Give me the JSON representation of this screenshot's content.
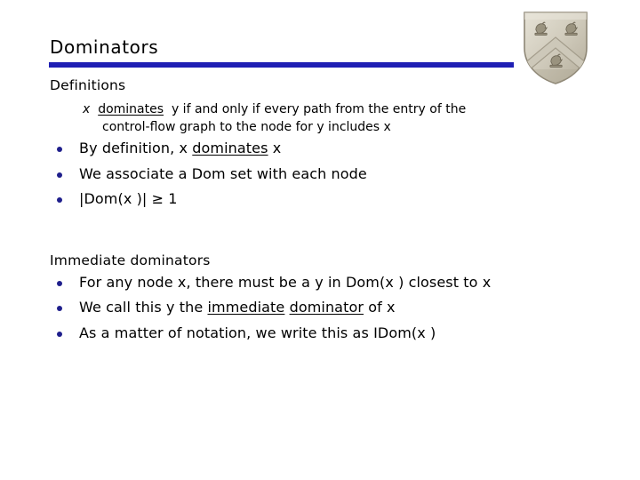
{
  "slide": {
    "title": "Dominators",
    "rule_color": "#1f1fb4",
    "bullet_color": "#1f1f8c"
  },
  "crest": {
    "name": "rice-university-shield-crest",
    "stone_light": "#dedacd",
    "stone_mid": "#c8c3b4",
    "stone_dark": "#a49d8c",
    "outline": "#7e7767"
  },
  "sections": [
    {
      "heading": "Definitions",
      "definition": {
        "line1_pre": "x",
        "line1_underlined": "dominates",
        "line1_post": "y if and only if every path from the entry of the",
        "line2": "control-flow graph to the node for y includes x"
      },
      "bullets": [
        {
          "pre": "By definition, x ",
          "underlined": "dominates",
          "post": " x"
        },
        {
          "pre": "We associate a Dom set with each node",
          "underlined": "",
          "post": ""
        },
        {
          "pre": "|Dom(x )| ≥ 1",
          "underlined": "",
          "post": ""
        }
      ]
    },
    {
      "heading": "Immediate dominators",
      "bullets": [
        {
          "pre": "For any node x, there must be a y in Dom(x ) closest to x",
          "underlined": "",
          "post": ""
        },
        {
          "pre": "We call this y the ",
          "underlined": "immediate",
          "mid": " ",
          "underlined2": "dominator",
          "post": " of x"
        },
        {
          "pre": "As a matter of notation, we write this as IDom(x )",
          "underlined": "",
          "post": ""
        }
      ]
    }
  ]
}
